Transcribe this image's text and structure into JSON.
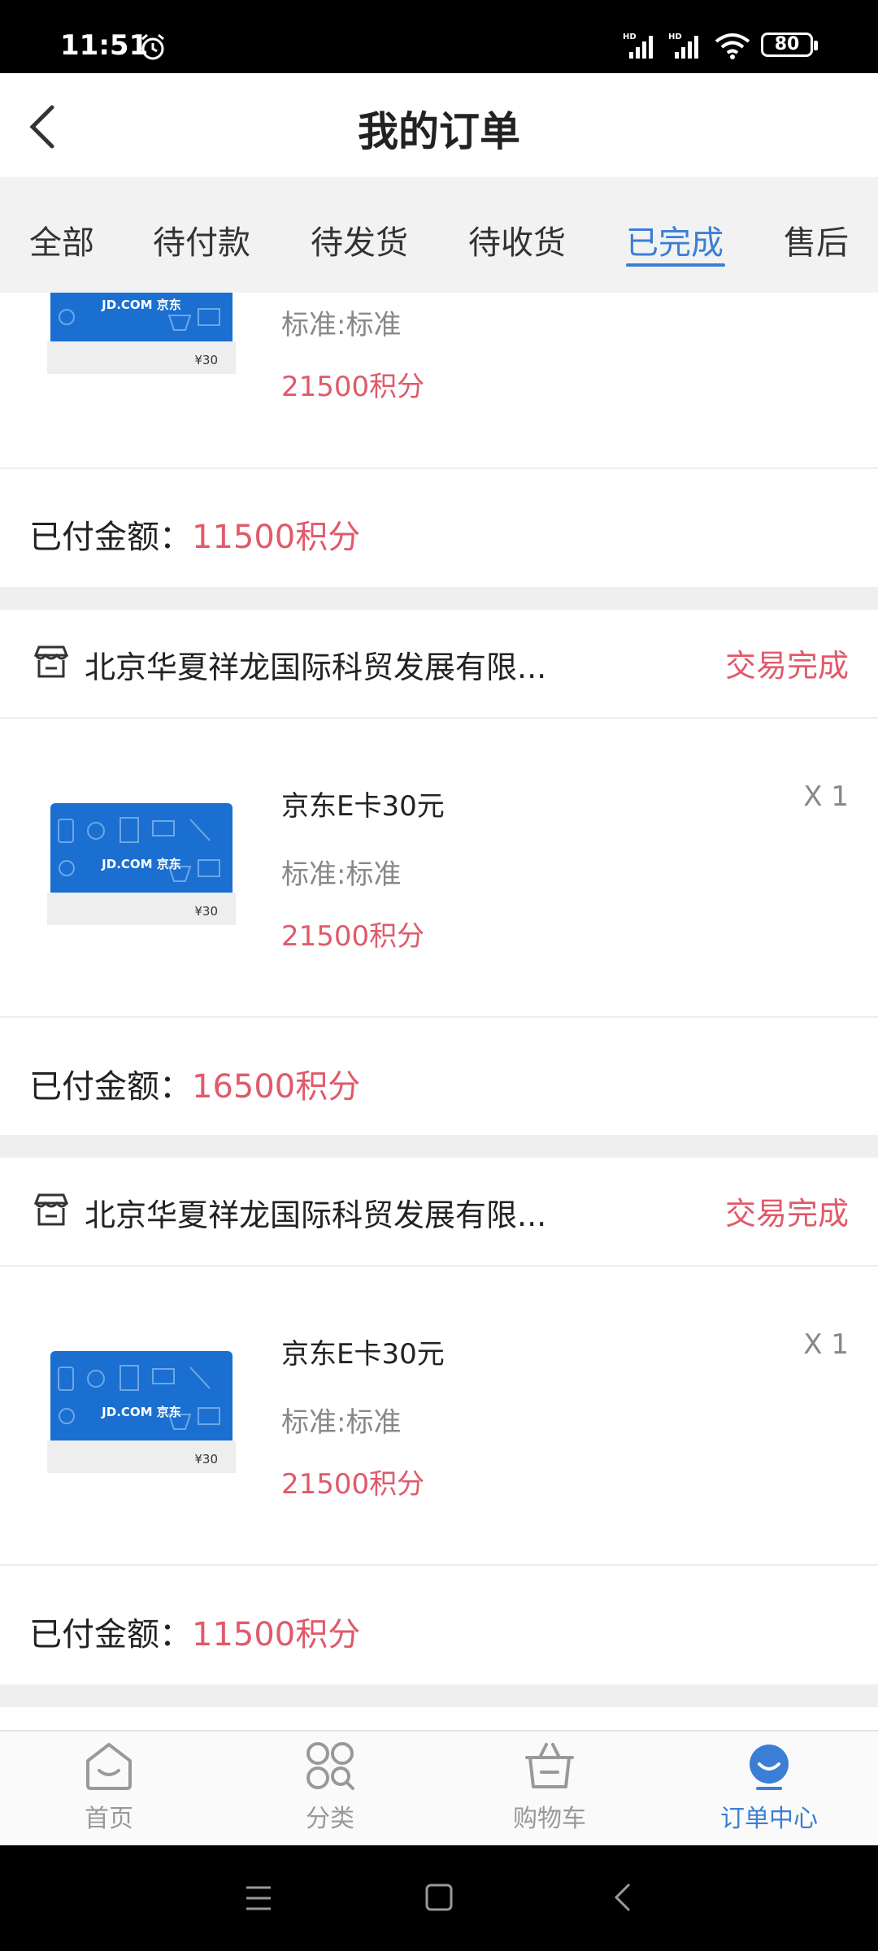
{
  "status": {
    "time": "11:51",
    "battery": "80",
    "signal1": "HD",
    "signal2": "HD"
  },
  "header": {
    "title": "我的订单"
  },
  "tabs": [
    {
      "label": "全部"
    },
    {
      "label": "待付款"
    },
    {
      "label": "待发货"
    },
    {
      "label": "待收货"
    },
    {
      "label": "已完成"
    },
    {
      "label": "售后"
    }
  ],
  "active_tab": "已完成",
  "orders": [
    {
      "item": {
        "spec": "标准:标准",
        "points": "21500积分",
        "card_price": "¥30"
      },
      "paid_label": "已付金额：",
      "paid_value": "11500积分"
    },
    {
      "shop": "北京华夏祥龙国际科贸发展有限...",
      "status": "交易完成",
      "item": {
        "name": "京东E卡30元",
        "spec": "标准:标准",
        "points": "21500积分",
        "qty": "X 1",
        "card_price": "¥30"
      },
      "paid_label": "已付金额：",
      "paid_value": "16500积分"
    },
    {
      "shop": "北京华夏祥龙国际科贸发展有限...",
      "status": "交易完成",
      "item": {
        "name": "京东E卡30元",
        "spec": "标准:标准",
        "points": "21500积分",
        "qty": "X 1",
        "card_price": "¥30"
      },
      "paid_label": "已付金额：",
      "paid_value": "11500积分"
    }
  ],
  "card_brand": "JD.COM 京东",
  "bottom_nav": [
    {
      "label": "首页",
      "icon": "home-icon"
    },
    {
      "label": "分类",
      "icon": "category-icon"
    },
    {
      "label": "购物车",
      "icon": "cart-icon"
    },
    {
      "label": "订单中心",
      "icon": "order-center-icon"
    }
  ],
  "colors": {
    "accent": "#3a7fd5",
    "price": "#e05a6a"
  }
}
